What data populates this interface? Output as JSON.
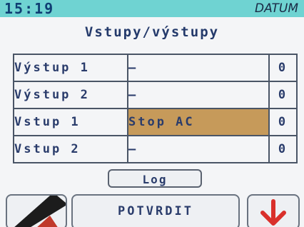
{
  "header": {
    "time": "15:19",
    "date_label": "DATUM"
  },
  "screen_title": "Vstupy/výstupy",
  "rows": [
    {
      "name": "Výstup 1",
      "value": "–",
      "count": "0"
    },
    {
      "name": "Výstup 2",
      "value": "–",
      "count": "0"
    },
    {
      "name": "Vstup 1",
      "value": "Stop AC",
      "count": "0"
    },
    {
      "name": "Vstup 2",
      "value": "–",
      "count": "0"
    }
  ],
  "buttons": {
    "log_label": "Log",
    "confirm_label": "POTVRDIT",
    "back_icon": "back-arrow-icon",
    "down_icon": "arrow-down-icon"
  },
  "colors": {
    "header_bg": "#6fd3d2",
    "highlight_cell": "#c69a5a",
    "down_arrow": "#d9302b"
  }
}
